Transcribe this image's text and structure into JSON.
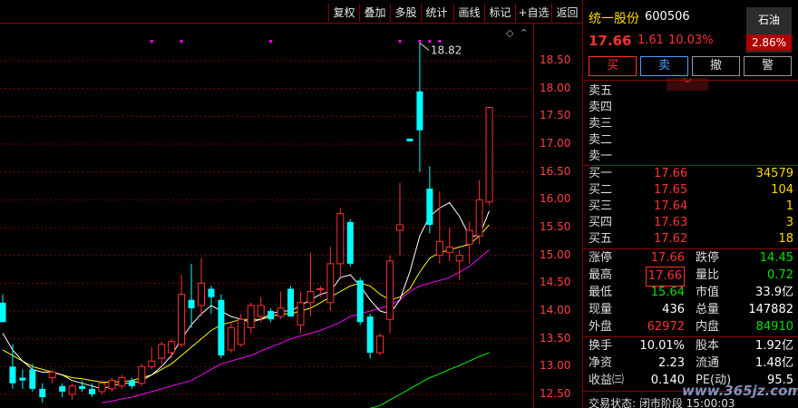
{
  "toolbar": {
    "buttons": [
      "复权",
      "叠加",
      "多股",
      "统计",
      "画线",
      "标记",
      "+自选",
      "返回"
    ]
  },
  "chart_data": {
    "type": "candlestick",
    "y_ticks": [
      "18.50",
      "18.00",
      "17.50",
      "17.00",
      "16.50",
      "16.00",
      "15.50",
      "15.00",
      "14.50",
      "14.00",
      "13.50",
      "13.00",
      "12.50"
    ],
    "ylim": [
      12.35,
      19.2
    ],
    "annotation": "18.82",
    "candles": [
      {
        "o": 14.15,
        "h": 14.3,
        "l": 13.8,
        "c": 13.8
      },
      {
        "o": 13.0,
        "h": 13.4,
        "l": 12.6,
        "c": 12.7
      },
      {
        "o": 12.8,
        "h": 12.95,
        "l": 12.6,
        "c": 12.75
      },
      {
        "o": 12.95,
        "h": 13.05,
        "l": 12.55,
        "c": 12.6
      },
      {
        "o": 12.6,
        "h": 12.7,
        "l": 12.35,
        "c": 12.45
      },
      {
        "o": 12.8,
        "h": 12.95,
        "l": 12.7,
        "c": 12.9
      },
      {
        "o": 12.65,
        "h": 12.7,
        "l": 12.45,
        "c": 12.55
      },
      {
        "o": 12.5,
        "h": 12.7,
        "l": 12.4,
        "c": 12.65
      },
      {
        "o": 12.65,
        "h": 12.75,
        "l": 12.55,
        "c": 12.6
      },
      {
        "o": 12.6,
        "h": 12.7,
        "l": 12.45,
        "c": 12.5
      },
      {
        "o": 12.55,
        "h": 12.75,
        "l": 12.5,
        "c": 12.7
      },
      {
        "o": 12.6,
        "h": 12.8,
        "l": 12.55,
        "c": 12.75
      },
      {
        "o": 12.65,
        "h": 12.85,
        "l": 12.6,
        "c": 12.8
      },
      {
        "o": 12.75,
        "h": 12.8,
        "l": 12.6,
        "c": 12.65
      },
      {
        "o": 12.7,
        "h": 13.05,
        "l": 12.65,
        "c": 13.0
      },
      {
        "o": 13.0,
        "h": 13.35,
        "l": 12.95,
        "c": 13.1
      },
      {
        "o": 13.15,
        "h": 13.45,
        "l": 13.05,
        "c": 13.4
      },
      {
        "o": 13.25,
        "h": 13.5,
        "l": 13.15,
        "c": 13.45
      },
      {
        "o": 13.4,
        "h": 14.65,
        "l": 13.35,
        "c": 14.3
      },
      {
        "o": 14.2,
        "h": 14.85,
        "l": 13.7,
        "c": 14.05
      },
      {
        "o": 14.1,
        "h": 14.95,
        "l": 13.9,
        "c": 14.5
      },
      {
        "o": 14.4,
        "h": 14.45,
        "l": 13.95,
        "c": 14.25
      },
      {
        "o": 14.2,
        "h": 14.3,
        "l": 13.15,
        "c": 13.2
      },
      {
        "o": 13.3,
        "h": 13.8,
        "l": 13.25,
        "c": 13.7
      },
      {
        "o": 13.4,
        "h": 13.95,
        "l": 13.35,
        "c": 13.85
      },
      {
        "o": 13.7,
        "h": 14.15,
        "l": 13.6,
        "c": 14.1
      },
      {
        "o": 13.9,
        "h": 14.25,
        "l": 13.8,
        "c": 14.1
      },
      {
        "o": 14.0,
        "h": 14.05,
        "l": 13.8,
        "c": 13.85
      },
      {
        "o": 13.9,
        "h": 14.35,
        "l": 13.85,
        "c": 14.05
      },
      {
        "o": 14.4,
        "h": 14.45,
        "l": 13.9,
        "c": 13.9
      },
      {
        "o": 13.75,
        "h": 14.35,
        "l": 13.6,
        "c": 14.15
      },
      {
        "o": 14.15,
        "h": 15.05,
        "l": 13.9,
        "c": 14.35
      },
      {
        "o": 14.4,
        "h": 14.45,
        "l": 14.25,
        "c": 14.4
      },
      {
        "o": 14.15,
        "h": 15.15,
        "l": 14.0,
        "c": 14.85
      },
      {
        "o": 14.85,
        "h": 15.85,
        "l": 14.6,
        "c": 15.75
      },
      {
        "o": 15.6,
        "h": 15.65,
        "l": 14.8,
        "c": 14.85
      },
      {
        "o": 14.55,
        "h": 14.6,
        "l": 13.75,
        "c": 13.8
      },
      {
        "o": 13.9,
        "h": 13.95,
        "l": 13.15,
        "c": 13.25
      },
      {
        "o": 13.25,
        "h": 13.6,
        "l": 13.2,
        "c": 13.55
      },
      {
        "o": 13.85,
        "h": 15.0,
        "l": 13.6,
        "c": 14.9
      },
      {
        "o": 15.45,
        "h": 16.3,
        "l": 15.0,
        "c": 15.55
      },
      {
        "o": 17.1,
        "h": 17.1,
        "l": 17.05,
        "c": 17.05
      },
      {
        "o": 17.95,
        "h": 18.82,
        "l": 16.5,
        "c": 17.25
      },
      {
        "o": 16.2,
        "h": 16.6,
        "l": 15.4,
        "c": 15.55
      },
      {
        "o": 15.0,
        "h": 16.15,
        "l": 14.85,
        "c": 15.25
      },
      {
        "o": 15.05,
        "h": 15.5,
        "l": 14.9,
        "c": 15.15
      },
      {
        "o": 14.9,
        "h": 15.1,
        "l": 14.55,
        "c": 15.0
      },
      {
        "o": 15.2,
        "h": 15.6,
        "l": 14.85,
        "c": 15.45
      },
      {
        "o": 15.35,
        "h": 16.35,
        "l": 15.2,
        "c": 16.0
      },
      {
        "o": 15.96,
        "h": 17.66,
        "l": 15.9,
        "c": 17.66
      }
    ],
    "ma5": [
      13.6,
      13.3,
      13.1,
      12.95,
      12.9,
      12.9,
      12.85,
      12.75,
      12.7,
      12.65,
      12.6,
      12.65,
      12.7,
      12.7,
      12.75,
      12.85,
      13.0,
      13.2,
      13.5,
      13.75,
      13.95,
      14.1,
      14.0,
      13.9,
      13.85,
      13.8,
      13.85,
      13.95,
      14.0,
      14.0,
      14.1,
      14.2,
      14.3,
      14.35,
      14.6,
      14.65,
      14.45,
      14.2,
      14.0,
      13.95,
      14.2,
      14.7,
      15.35,
      15.7,
      15.85,
      15.95,
      15.7,
      15.35,
      15.35,
      15.8
    ],
    "ma10": [
      13.3,
      13.2,
      13.1,
      13.0,
      12.95,
      12.9,
      12.85,
      12.8,
      12.78,
      12.75,
      12.72,
      12.72,
      12.73,
      12.75,
      12.8,
      12.85,
      12.95,
      13.05,
      13.2,
      13.35,
      13.5,
      13.65,
      13.75,
      13.8,
      13.85,
      13.85,
      13.85,
      13.9,
      13.95,
      13.95,
      14.0,
      14.05,
      14.15,
      14.25,
      14.35,
      14.45,
      14.5,
      14.45,
      14.3,
      14.2,
      14.25,
      14.4,
      14.7,
      14.95,
      15.05,
      15.1,
      15.15,
      15.2,
      15.35,
      15.55
    ],
    "ma20": [
      null,
      null,
      null,
      null,
      null,
      null,
      null,
      null,
      null,
      null,
      12.35,
      12.38,
      12.42,
      12.45,
      12.5,
      12.55,
      12.6,
      12.65,
      12.7,
      12.75,
      12.85,
      12.95,
      13.05,
      13.1,
      13.15,
      13.2,
      13.28,
      13.35,
      13.42,
      13.5,
      13.55,
      13.6,
      13.65,
      13.72,
      13.8,
      13.9,
      13.95,
      14.0,
      14.05,
      14.1,
      14.2,
      14.35,
      14.45,
      14.5,
      14.55,
      14.6,
      14.7,
      14.8,
      14.95,
      15.1
    ],
    "ma60": [
      null,
      null,
      null,
      null,
      null,
      null,
      null,
      null,
      null,
      null,
      null,
      null,
      null,
      null,
      null,
      null,
      null,
      null,
      null,
      null,
      null,
      null,
      null,
      null,
      null,
      null,
      null,
      null,
      null,
      null,
      null,
      null,
      null,
      null,
      null,
      null,
      12.2,
      12.25,
      12.3,
      12.4,
      12.5,
      12.6,
      12.7,
      12.8,
      12.87,
      12.95,
      13.02,
      13.1,
      13.18,
      13.25
    ]
  },
  "quote": {
    "name": "统一股份",
    "code": "600506",
    "sector_name": "石油",
    "sector_change": "2.86%",
    "price": "17.66",
    "change": "1.61",
    "change_pct": "10.03%",
    "trade_buttons": [
      "买",
      "卖",
      "撤",
      "警"
    ],
    "asks": [
      {
        "label": "卖五"
      },
      {
        "label": "卖四"
      },
      {
        "label": "卖三"
      },
      {
        "label": "卖二"
      },
      {
        "label": "卖一"
      }
    ],
    "bids": [
      {
        "label": "买一",
        "price": "17.66",
        "vol": "34579"
      },
      {
        "label": "买二",
        "price": "17.65",
        "vol": "104"
      },
      {
        "label": "买三",
        "price": "17.64",
        "vol": "1"
      },
      {
        "label": "买四",
        "price": "17.63",
        "vol": "3"
      },
      {
        "label": "买五",
        "price": "17.62",
        "vol": "18"
      }
    ],
    "stats1": [
      {
        "l1": "涨停",
        "v1": "17.66",
        "l2": "跌停",
        "v2": "14.45"
      },
      {
        "l1": "最高",
        "v1": "17.66",
        "l2": "量比",
        "v2": "0.72"
      },
      {
        "l1": "最低",
        "v1": "15.64",
        "l2": "市值",
        "v2": "33.9亿"
      },
      {
        "l1": "现量",
        "v1": "436",
        "l2": "总量",
        "v2": "147882"
      },
      {
        "l1": "外盘",
        "v1": "62972",
        "l2": "内盘",
        "v2": "84910"
      }
    ],
    "stats2": [
      {
        "l1": "换手",
        "v1": "10.01%",
        "l2": "股本",
        "v2": "1.92亿"
      },
      {
        "l1": "净资",
        "v1": "2.23",
        "l2": "流通",
        "v2": "1.48亿"
      },
      {
        "l1": "收益㈢",
        "v1": "0.140",
        "l2": "PE(动)",
        "v2": "95.5"
      }
    ],
    "status": "交易状态: 闭市阶段 15:00:03"
  },
  "watermark": "www.365jz.com",
  "colors": {
    "up": "#ff3030",
    "down": "#00ffff",
    "ma5": "#ffffff",
    "ma10": "#ffff00",
    "ma20": "#ff00ff",
    "ma60": "#00ff00"
  }
}
